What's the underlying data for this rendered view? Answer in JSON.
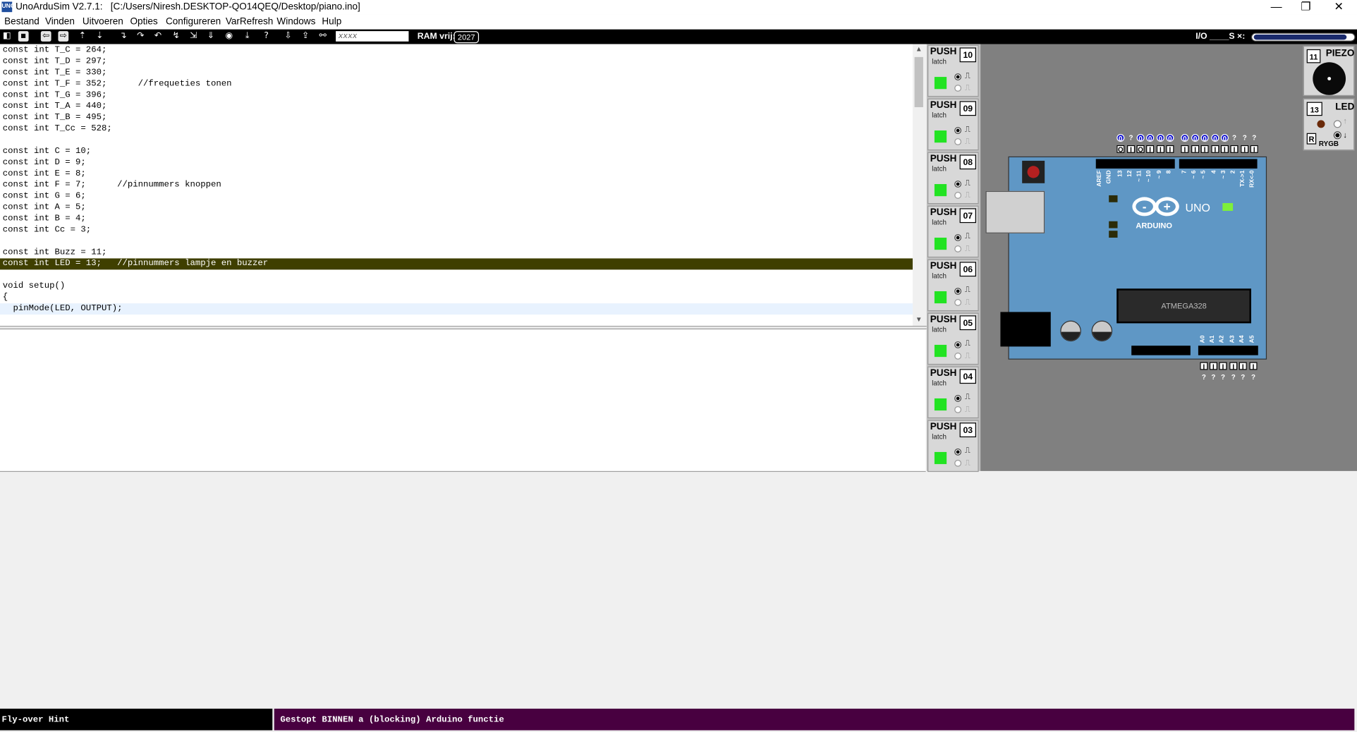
{
  "window": {
    "app_name": "UnoArduSim V2.7.1:",
    "file_path": "[C:/Users/Niresh.DESKTOP-QO14QEQ/Desktop/piano.ino]",
    "icon_text": "UNO",
    "min_glyph": "—",
    "max_glyph": "❐",
    "close_glyph": "✕"
  },
  "menu": [
    "Bestand",
    "Vinden",
    "Uitvoeren",
    "Opties",
    "Configureren",
    "VarRefresh",
    "Windows",
    "Hulp"
  ],
  "toolbar": {
    "find_placeholder": "xxxx",
    "ram_label": "RAM vrij:",
    "ram_value": "2027",
    "io_label": "I/O ____S ×:",
    "io_slider_level": 0.92
  },
  "code_lines": [
    "const int T_C = 264;",
    "const int T_D = 297;",
    "const int T_E = 330;",
    "const int T_F = 352;      //frequeties tonen",
    "const int T_G = 396;",
    "const int T_A = 440;",
    "const int T_B = 495;",
    "const int T_Cc = 528;",
    "",
    "const int C = 10;",
    "const int D = 9;",
    "const int E = 8;",
    "const int F = 7;      //pinnummers knoppen",
    "const int G = 6;",
    "const int A = 5;",
    "const int B = 4;",
    "const int Cc = 3;",
    "",
    "const int Buzz = 11;",
    "const int LED = 13;   //pinnummers lampje en buzzer",
    "",
    "void setup()",
    "{",
    "  pinMode(LED, OUTPUT);"
  ],
  "highlight_line": 19,
  "cursor_line": 23,
  "push_modules": [
    {
      "label": "PUSH",
      "sub": "latch",
      "pin": "10"
    },
    {
      "label": "PUSH",
      "sub": "latch",
      "pin": "09"
    },
    {
      "label": "PUSH",
      "sub": "latch",
      "pin": "08"
    },
    {
      "label": "PUSH",
      "sub": "latch",
      "pin": "07"
    },
    {
      "label": "PUSH",
      "sub": "latch",
      "pin": "06"
    },
    {
      "label": "PUSH",
      "sub": "latch",
      "pin": "05"
    },
    {
      "label": "PUSH",
      "sub": "latch",
      "pin": "04"
    },
    {
      "label": "PUSH",
      "sub": "latch",
      "pin": "03"
    }
  ],
  "push_symbols": {
    "rising": "⎍",
    "falling": "⎍"
  },
  "board": {
    "chip": "ATMEGA328",
    "uno": "UNO",
    "arduino": "ARDUINO",
    "logo_minus": "-",
    "logo_plus": "+",
    "top_pin_labels": [
      "AREF",
      "GND",
      "13",
      "12",
      "~ 11",
      "~ 10",
      "~ 9",
      "8",
      "7",
      "~ 6",
      "~ 5",
      "4",
      "~ 3",
      "2",
      "TX->1",
      "RX<-0"
    ],
    "top_sig_group1": [
      "0",
      "?",
      "0",
      "0",
      "0",
      "0"
    ],
    "top_dir_group1": [
      "O",
      "I",
      "O",
      "I",
      "I",
      "I"
    ],
    "top_sig_group2": [
      "0",
      "0",
      "0",
      "0",
      "0",
      "?",
      "?",
      "?"
    ],
    "top_dir_group2": [
      "I",
      "I",
      "I",
      "I",
      "I",
      "I",
      "I",
      "I"
    ],
    "bottom_pin_labels": [
      "A0",
      "A1",
      "A2",
      "A3",
      "A4",
      "A5"
    ],
    "bottom_dir": [
      "I",
      "I",
      "I",
      "I",
      "I",
      "I"
    ],
    "bottom_sig": [
      "?",
      "?",
      "?",
      "?",
      "?",
      "?"
    ]
  },
  "piezo": {
    "pin": "11",
    "label": "PIEZO"
  },
  "led": {
    "pin": "13",
    "label": "LED",
    "r": "R",
    "colors": "RYGB"
  },
  "status": {
    "hint": "Fly-over Hint",
    "message": "Gestopt BINNEN a (blocking) Arduino functie"
  },
  "colors": {
    "highlight": "#3f3f00",
    "status_right": "#480040",
    "push_green": "#22e322"
  }
}
